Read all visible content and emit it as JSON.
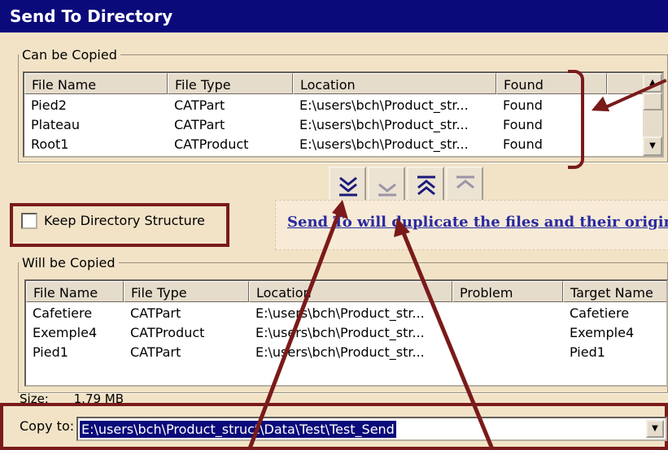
{
  "window": {
    "title": "Send To Directory"
  },
  "can_be_copied": {
    "legend": "Can be Copied",
    "columns": [
      "File Name",
      "File Type",
      "Location",
      "Found"
    ],
    "rows": [
      [
        "Pied2",
        "CATPart",
        "E:\\users\\bch\\Product_str...",
        "Found"
      ],
      [
        "Plateau",
        "CATPart",
        "E:\\users\\bch\\Product_str...",
        "Found"
      ],
      [
        "Root1",
        "CATProduct",
        "E:\\users\\bch\\Product_str...",
        "Found"
      ]
    ]
  },
  "move_buttons": [
    {
      "name": "move-all-down",
      "icon": "double-chevron-down-icon"
    },
    {
      "name": "move-selected-down",
      "icon": "chevron-down-icon"
    },
    {
      "name": "move-all-up",
      "icon": "double-chevron-up-icon"
    },
    {
      "name": "move-selected-up",
      "icon": "chevron-up-icon"
    }
  ],
  "keep_structure": {
    "label": "Keep Directory Structure",
    "checked": false
  },
  "info_text": "Send To will duplicate the files and their original str",
  "will_be_copied": {
    "legend": "Will be Copied",
    "columns": [
      "File Name",
      "File Type",
      "Location",
      "Problem",
      "Target Name"
    ],
    "rows": [
      [
        "Cafetiere",
        "CATPart",
        "E:\\users\\bch\\Product_str...",
        "",
        "Cafetiere"
      ],
      [
        "Exemple4",
        "CATProduct",
        "E:\\users\\bch\\Product_str...",
        "",
        "Exemple4"
      ],
      [
        "Pied1",
        "CATPart",
        "E:\\users\\bch\\Product_str...",
        "",
        "Pied1"
      ]
    ]
  },
  "size": {
    "label": "Size:",
    "value": "1.79 MB"
  },
  "copy_to": {
    "label": "Copy to:",
    "value": "E:\\users\\bch\\Product_struct\\Data\\Test\\Test_Send"
  },
  "colors": {
    "titlebar": "#0a0a7a",
    "annotation": "#7a1a1a",
    "background": "#f2e3c7",
    "link": "#2a2aa0"
  }
}
